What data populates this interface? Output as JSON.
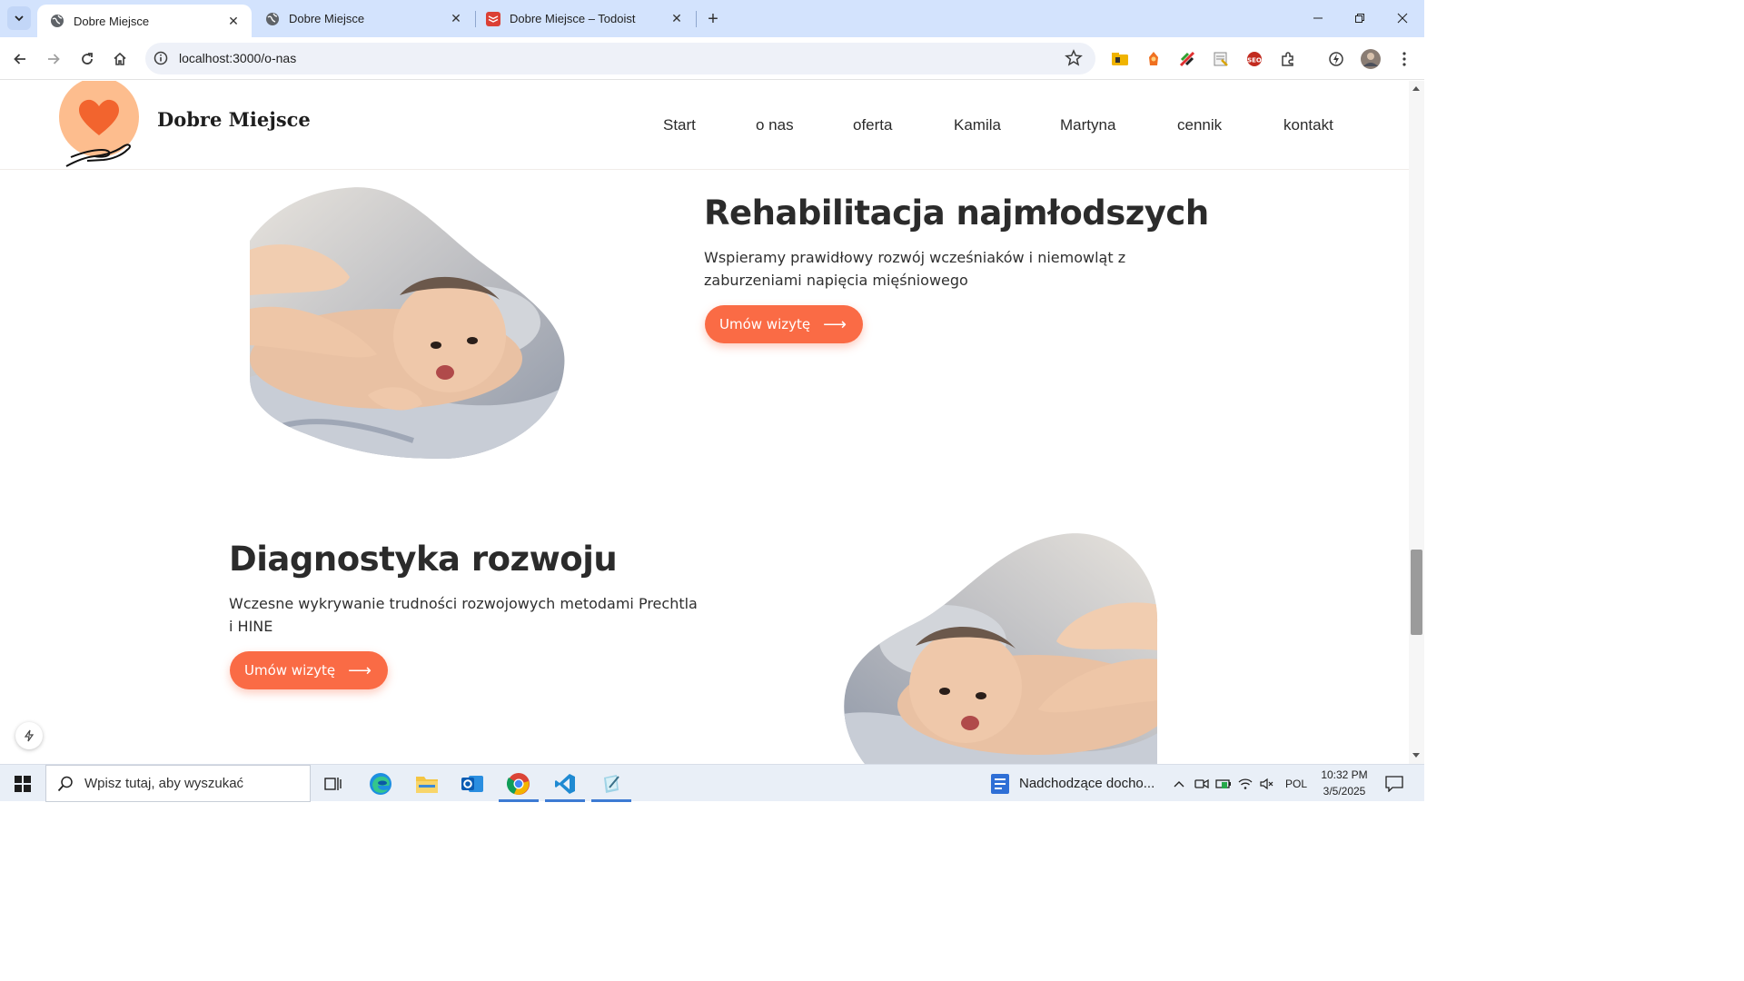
{
  "browser": {
    "tabs": [
      {
        "title": "Dobre Miejsce",
        "active": true
      },
      {
        "title": "Dobre Miejsce",
        "active": false
      },
      {
        "title": "Dobre Miejsce – Todoist",
        "active": false
      }
    ],
    "url": "localhost:3000/o-nas"
  },
  "site": {
    "brand": "Dobre Miejsce",
    "nav": [
      "Start",
      "o nas",
      "oferta",
      "Kamila",
      "Martyna",
      "cennik",
      "kontakt"
    ],
    "sections": [
      {
        "title": "Rehabilitacja najmłodszych",
        "text": "Wspieramy prawidłowy rozwój wcześniaków i niemowląt z zaburzeniami napięcia mięśniowego",
        "cta": "Umów wizytę"
      },
      {
        "title": "Diagnostyka rozwoju",
        "text": "Wczesne wykrywanie trudności rozwojowych metodami Prechtla i HINE",
        "cta": "Umów wizytę"
      }
    ],
    "colors": {
      "accent": "#fa6b45",
      "logo_circle": "#fdbd8e",
      "heart": "#f2642e"
    }
  },
  "taskbar": {
    "search_placeholder": "Wpisz tutaj, aby wyszukać",
    "notification": "Nadchodzące docho...",
    "language": "POL",
    "time": "10:32 PM",
    "date": "3/5/2025"
  }
}
